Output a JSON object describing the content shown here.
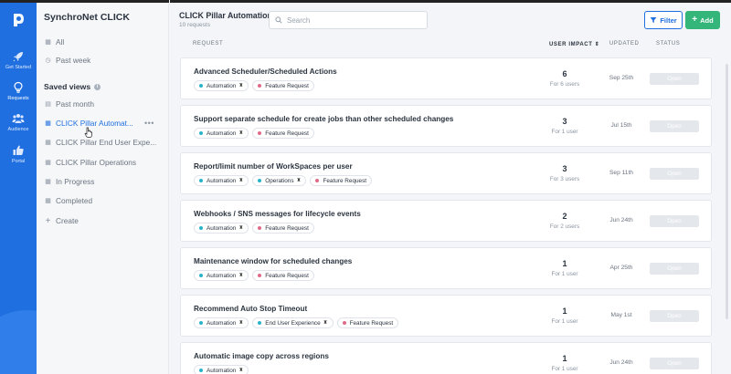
{
  "rail": {
    "items": [
      {
        "label": "Get Started",
        "icon": "rocket-icon"
      },
      {
        "label": "Requests",
        "icon": "lightbulb-icon"
      },
      {
        "label": "Audience",
        "icon": "users-icon"
      },
      {
        "label": "Portal",
        "icon": "thumbs-up-icon"
      }
    ]
  },
  "nav": {
    "title": "SynchroNet CLICK",
    "all": "All",
    "past_week": "Past week",
    "saved_views_title": "Saved views",
    "saved_views": [
      {
        "label": "Past month",
        "icon": "dashed-grid-icon"
      },
      {
        "label": "CLICK Pillar Automat...",
        "icon": "grid-icon"
      },
      {
        "label": "CLICK Pillar End User Expe...",
        "icon": "grid-icon"
      },
      {
        "label": "CLICK Pillar Operations",
        "icon": "grid-icon"
      },
      {
        "label": "In Progress",
        "icon": "grid-icon"
      },
      {
        "label": "Completed",
        "icon": "grid-icon"
      }
    ],
    "create": "Create"
  },
  "header": {
    "title": "CLICK Pillar Automation",
    "subtitle": "10 requests",
    "search_placeholder": "Search",
    "filter_label": "Filter",
    "add_label": "Add"
  },
  "columns": {
    "request": "Request",
    "impact": "User impact",
    "updated": "Updated",
    "status": "Status"
  },
  "colors": {
    "automation": "#2bb3c9",
    "feature_request": "#e06a8a",
    "operations": "#2bb3c9",
    "end_user_experience": "#2bb3c9",
    "primary": "#1f6fe0",
    "add": "#34b57a"
  },
  "requests": [
    {
      "title": "Advanced Scheduler/Scheduled Actions",
      "tags": [
        "Automation",
        "Feature Request"
      ],
      "votes": "6",
      "users": "For 6 users",
      "date": "Sep 25th",
      "status": "Open"
    },
    {
      "title": "Support separate schedule for create jobs than other scheduled changes",
      "tags": [
        "Automation",
        "Feature Request"
      ],
      "votes": "3",
      "users": "For 1 user",
      "date": "Jul 15th",
      "status": "Open"
    },
    {
      "title": "Report/limit number of WorkSpaces per user",
      "tags": [
        "Automation",
        "Operations",
        "Feature Request"
      ],
      "votes": "3",
      "users": "For 3 users",
      "date": "Sep 11th",
      "status": "Open"
    },
    {
      "title": "Webhooks / SNS messages for lifecycle events",
      "tags": [
        "Automation",
        "Feature Request"
      ],
      "votes": "2",
      "users": "For 2 users",
      "date": "Jun 24th",
      "status": "Open"
    },
    {
      "title": "Maintenance window for scheduled changes",
      "tags": [
        "Automation",
        "Feature Request"
      ],
      "votes": "1",
      "users": "For 1 user",
      "date": "Apr 25th",
      "status": "Open"
    },
    {
      "title": "Recommend Auto Stop Timeout",
      "tags": [
        "Automation",
        "End User Experience",
        "Feature Request"
      ],
      "votes": "1",
      "users": "For 1 user",
      "date": "May 1st",
      "status": "Open"
    },
    {
      "title": "Automatic image copy across regions",
      "tags": [
        "Automation"
      ],
      "votes": "1",
      "users": "For 1 user",
      "date": "Jun 24th",
      "status": "Open"
    }
  ]
}
